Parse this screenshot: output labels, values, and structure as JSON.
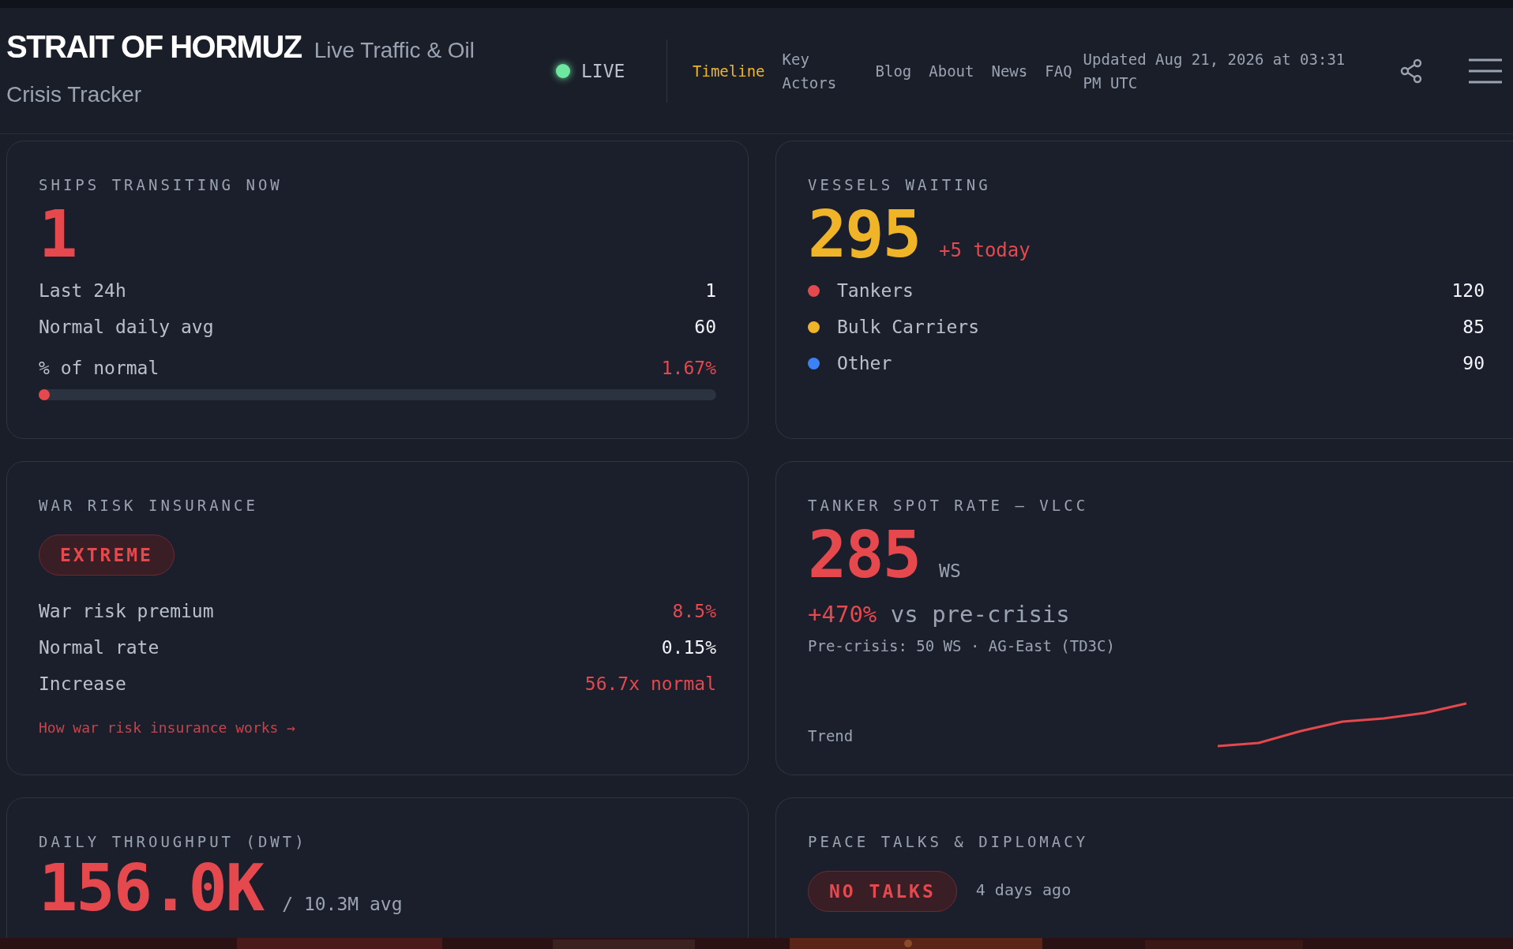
{
  "header": {
    "title": "STRAIT OF HORMUZ",
    "subtitle": "Live Traffic & Oil Crisis Tracker",
    "live": {
      "label": "LIVE",
      "on": true
    },
    "nav": [
      {
        "label": "Timeline",
        "selected": true
      },
      {
        "label": "Key Actors",
        "selected": false
      },
      {
        "label": "Blog",
        "selected": false
      },
      {
        "label": "About",
        "selected": false
      },
      {
        "label": "News",
        "selected": false
      },
      {
        "label": "FAQ",
        "selected": false
      }
    ],
    "updated": "Updated Aug 21, 2026 at 03:31 PM UTC"
  },
  "ships_transiting": {
    "label": "SHIPS TRANSITING NOW",
    "value": "1",
    "rows": [
      {
        "label": "Last 24h",
        "value": "1",
        "alert": false
      },
      {
        "label": "Normal daily avg",
        "value": "60",
        "alert": false
      }
    ],
    "percent": {
      "label": "% of normal",
      "value": "1.67%",
      "level": 0.0167
    }
  },
  "vessels_waiting": {
    "label": "VESSELS WAITING",
    "value": "295",
    "delta": "+5 today",
    "rows": [
      {
        "label": "Tankers",
        "value": "120",
        "color": "#e5484d"
      },
      {
        "label": "Bulk Carriers",
        "value": "85",
        "color": "#f0b429"
      },
      {
        "label": "Other",
        "value": "90",
        "color": "#3b82f6"
      }
    ]
  },
  "war_risk_insurance": {
    "label": "WAR RISK INSURANCE",
    "badge": "EXTREME",
    "rows": [
      {
        "label": "War risk premium",
        "value": "8.5%",
        "alert": true
      },
      {
        "label": "Normal rate",
        "value": "0.15%",
        "alert": false
      },
      {
        "label": "Increase",
        "value": "56.7x normal",
        "alert": true
      }
    ],
    "link": "How war risk insurance works →"
  },
  "tanker_spot_rate": {
    "label": "TANKER SPOT RATE — VLCC",
    "value": "285",
    "unit": "WS",
    "change": "+470%",
    "change_note": "vs pre-crisis",
    "detail": "Pre-crisis: 50 WS · AG-East (TD3C)",
    "trend_label": "Trend"
  },
  "daily_throughput": {
    "label": "DAILY THROUGHPUT (DWT)",
    "value": "156.0K",
    "note": "/ 10.3M avg"
  },
  "peace_talks": {
    "label": "PEACE TALKS & DIPLOMACY",
    "badge": "NO TALKS",
    "since": "4 days ago"
  }
}
